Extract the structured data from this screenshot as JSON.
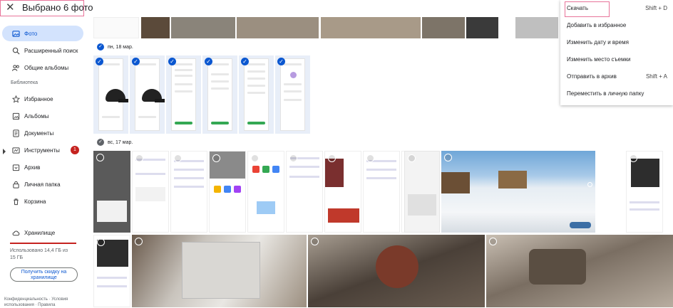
{
  "topbar": {
    "close_icon": "close-icon",
    "title": "Выбрано 6 фото"
  },
  "sidebar": {
    "items": [
      {
        "label": "Фото",
        "icon": "photo-icon",
        "active": true
      },
      {
        "label": "Расширенный поиск",
        "icon": "search-icon"
      },
      {
        "label": "Общие альбомы",
        "icon": "people-icon"
      }
    ],
    "library_label": "Библиотека",
    "library_items": [
      {
        "label": "Избранное",
        "icon": "star-icon"
      },
      {
        "label": "Альбомы",
        "icon": "album-icon"
      },
      {
        "label": "Документы",
        "icon": "document-icon"
      },
      {
        "label": "Инструменты",
        "icon": "tools-icon",
        "badge": "1"
      },
      {
        "label": "Архив",
        "icon": "archive-icon"
      },
      {
        "label": "Личная папка",
        "icon": "lock-folder-icon"
      },
      {
        "label": "Корзина",
        "icon": "trash-icon"
      }
    ],
    "storage_label": "Хранилище",
    "storage_text": "Использовано 14,4 ГБ из 15 ГБ",
    "storage_used_fraction": 0.96,
    "promo_button": "Получить скидку на хранилище",
    "footer": "Конфиденциальность · Условия использования · Правила"
  },
  "dates": {
    "first": "пн, 18 мар.",
    "second": "вс, 17 мар."
  },
  "menu": {
    "items": [
      {
        "label": "Скачать",
        "shortcut": "Shift + D"
      },
      {
        "label": "Добавить в избранное",
        "shortcut": ""
      },
      {
        "label": "Изменить дату и время",
        "shortcut": ""
      },
      {
        "label": "Изменить место съемки",
        "shortcut": ""
      },
      {
        "label": "Отправить в архив",
        "shortcut": "Shift + A"
      },
      {
        "label": "Переместить в личную папку",
        "shortcut": ""
      }
    ]
  },
  "selected_count": 6,
  "colors": {
    "accent": "#0b57d0",
    "active_nav": "#d3e3fd",
    "badge": "#c5221f",
    "highlight_box": "#e8749a"
  }
}
